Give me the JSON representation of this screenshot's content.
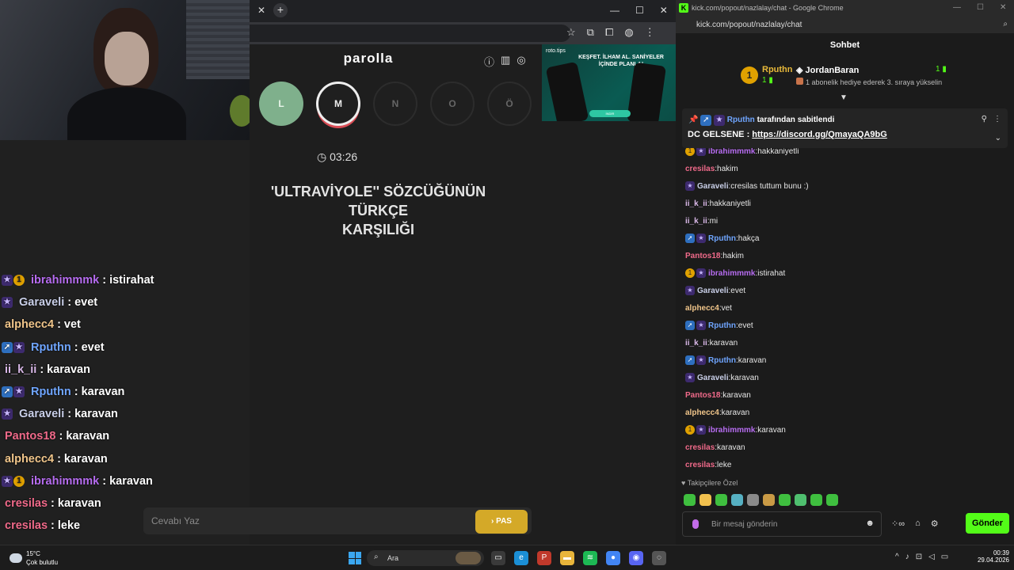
{
  "game": {
    "title": "parolla",
    "letters": [
      {
        "label": "L",
        "state": "done"
      },
      {
        "label": "M",
        "state": "active"
      },
      {
        "label": "N",
        "state": "idle"
      },
      {
        "label": "O",
        "state": "idle"
      },
      {
        "label": "Ö",
        "state": "idle"
      }
    ],
    "timer": "03:26",
    "question_line1": "'ULTRAVİYOLE'' SÖZCÜĞÜNÜN TÜRKÇE",
    "question_line2": "KARŞILIĞI",
    "answer_placeholder": "Cevabı Yaz",
    "pass_label": "PAS",
    "pass_icon": "chevron-right-icon",
    "icons": [
      "info-icon",
      "stats-icon",
      "profile-icon"
    ]
  },
  "ad": {
    "brand": "roto.tips",
    "headline": "KEŞFET. İLHAM AL. SANİYELER İÇİNDE PLANLA!",
    "cta": "İNDİR"
  },
  "overlay_chat": [
    {
      "user": "ibrahimmmk",
      "color": "#b66cf0",
      "badges": [
        "star",
        "one"
      ],
      "text": "istirahat"
    },
    {
      "user": "Garaveli",
      "color": "#c9cfe8",
      "badges": [
        "star"
      ],
      "text": "evet"
    },
    {
      "user": "alphecc4",
      "color": "#f0c58a",
      "badges": [],
      "text": "vet"
    },
    {
      "user": "Rputhn",
      "color": "#6fa5ff",
      "badges": [
        "gift",
        "star"
      ],
      "text": "evet"
    },
    {
      "user": "ii_k_ii",
      "color": "#d9b8e8",
      "badges": [],
      "text": "karavan"
    },
    {
      "user": "Rputhn",
      "color": "#6fa5ff",
      "badges": [
        "gift",
        "star"
      ],
      "text": "karavan"
    },
    {
      "user": "Garaveli",
      "color": "#c9cfe8",
      "badges": [
        "star"
      ],
      "text": "karavan"
    },
    {
      "user": "Pantos18",
      "color": "#f06a8a",
      "badges": [],
      "text": "karavan"
    },
    {
      "user": "alphecc4",
      "color": "#f0c58a",
      "badges": [],
      "text": "karavan"
    },
    {
      "user": "ibrahimmmk",
      "color": "#b66cf0",
      "badges": [
        "star",
        "one"
      ],
      "text": "karavan"
    },
    {
      "user": "cresilas",
      "color": "#f06a8a",
      "badges": [],
      "text": "karavan"
    },
    {
      "user": "cresilas",
      "color": "#f06a8a",
      "badges": [],
      "text": "leke"
    }
  ],
  "chat_window": {
    "title": "kick.com/popout/nazlalay/chat - Google Chrome",
    "url": "kick.com/popout/nazlalay/chat",
    "header": "Sohbet",
    "leaderboard": {
      "rank": "1",
      "user1": "Rputhn",
      "user1_count": "1",
      "user2": "JordanBaran",
      "user2_count": "1",
      "description": "1 abonelik hediye ederek 3. sıraya yükselin"
    },
    "pinned": {
      "user": "Rputhn",
      "suffix": "tarafından sabitlendi",
      "prefix": "DC GELSENE :",
      "link": "https://discord.gg/QmayaQA9bG"
    },
    "messages": [
      {
        "user": "ibrahimmmk",
        "color": "#b66cf0",
        "badges": [
          "one",
          "star"
        ],
        "text": "hakkaniyetli",
        "partial": true
      },
      {
        "user": "cresilas",
        "color": "#f06a8a",
        "badges": [],
        "text": "hakim"
      },
      {
        "user": "Garaveli",
        "color": "#c9cfe8",
        "badges": [
          "star"
        ],
        "text": "cresilas tuttum bunu :)"
      },
      {
        "user": "ii_k_ii",
        "color": "#d9b8e8",
        "badges": [],
        "text": "hakkaniyetli"
      },
      {
        "user": "ii_k_ii",
        "color": "#d9b8e8",
        "badges": [],
        "text": "mi"
      },
      {
        "user": "Rputhn",
        "color": "#6fa5ff",
        "badges": [
          "gift",
          "star"
        ],
        "text": "hakça"
      },
      {
        "user": "Pantos18",
        "color": "#f06a8a",
        "badges": [],
        "text": "hakim"
      },
      {
        "user": "ibrahimmmk",
        "color": "#b66cf0",
        "badges": [
          "one",
          "star"
        ],
        "text": "istirahat"
      },
      {
        "user": "Garaveli",
        "color": "#c9cfe8",
        "badges": [
          "star"
        ],
        "text": "evet"
      },
      {
        "user": "alphecc4",
        "color": "#f0c58a",
        "badges": [],
        "text": "vet"
      },
      {
        "user": "Rputhn",
        "color": "#6fa5ff",
        "badges": [
          "gift",
          "star"
        ],
        "text": "evet"
      },
      {
        "user": "ii_k_ii",
        "color": "#d9b8e8",
        "badges": [],
        "text": "karavan"
      },
      {
        "user": "Rputhn",
        "color": "#6fa5ff",
        "badges": [
          "gift",
          "star"
        ],
        "text": "karavan"
      },
      {
        "user": "Garaveli",
        "color": "#c9cfe8",
        "badges": [
          "star"
        ],
        "text": "karavan"
      },
      {
        "user": "Pantos18",
        "color": "#f06a8a",
        "badges": [],
        "text": "karavan"
      },
      {
        "user": "alphecc4",
        "color": "#f0c58a",
        "badges": [],
        "text": "karavan"
      },
      {
        "user": "ibrahimmmk",
        "color": "#b66cf0",
        "badges": [
          "one",
          "star"
        ],
        "text": "karavan"
      },
      {
        "user": "cresilas",
        "color": "#f06a8a",
        "badges": [],
        "text": "karavan"
      },
      {
        "user": "cresilas",
        "color": "#f06a8a",
        "badges": [],
        "text": "leke"
      }
    ],
    "follower_only": "Takipçilere Özel",
    "emote_colors": [
      "#3fbf3f",
      "#f2c14e",
      "#3fbf3f",
      "#56b0c2",
      "#8a8a8a",
      "#c99a45",
      "#3fbf3f",
      "#4fbf6f",
      "#3fbf3f",
      "#3fbf3f"
    ],
    "input_placeholder": "Bir mesaj gönderin",
    "send_label": "Gönder"
  },
  "taskbar": {
    "temperature": "15°C",
    "weather": "Çok bulutlu",
    "search_label": "Ara",
    "time": "00:39",
    "date": "29.04.2026",
    "apps": [
      {
        "name": "file-explorer-icon",
        "color": "#3a3a3a",
        "glyph": "▭"
      },
      {
        "name": "edge-icon",
        "color": "#1b8fd6",
        "glyph": "e"
      },
      {
        "name": "app-p-icon",
        "color": "#c0392b",
        "glyph": "P"
      },
      {
        "name": "folder-icon",
        "color": "#e8b53b",
        "glyph": "▬"
      },
      {
        "name": "spotify-icon",
        "color": "#1db954",
        "glyph": "≋"
      },
      {
        "name": "chrome-icon",
        "color": "#4285f4",
        "glyph": "●"
      },
      {
        "name": "discord-icon",
        "color": "#5865f2",
        "glyph": "◉"
      },
      {
        "name": "app-circle-icon",
        "color": "#555555",
        "glyph": "◌"
      }
    ]
  }
}
